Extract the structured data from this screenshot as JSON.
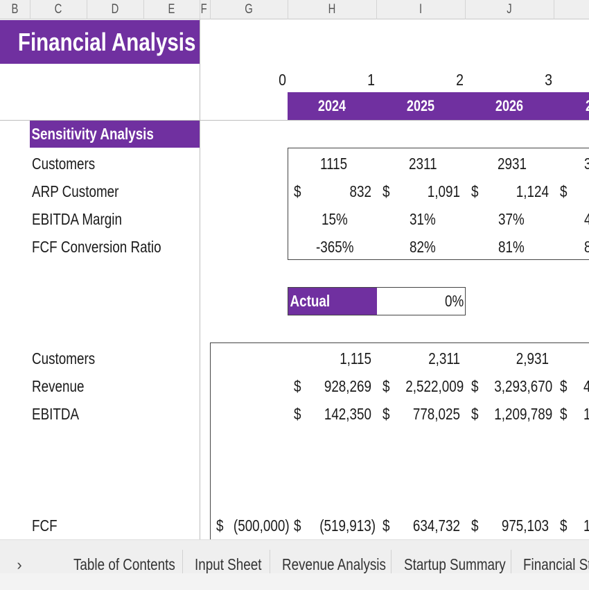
{
  "columns": [
    "B",
    "C",
    "D",
    "E",
    "F",
    "G",
    "H",
    "I",
    "J"
  ],
  "title": "Financial Analysis",
  "period_index": [
    "0",
    "1",
    "2",
    "3"
  ],
  "years": [
    "2024",
    "2025",
    "2026",
    "2"
  ],
  "sensitivity": {
    "header": "Sensitivity Analysis",
    "rows": [
      {
        "label": "Customers",
        "values": [
          "1115",
          "2311",
          "2931",
          "3"
        ]
      },
      {
        "label": "ARP Customer",
        "currency": "$",
        "values": [
          "832",
          "1,091",
          "1,124",
          ""
        ]
      },
      {
        "label": "EBITDA Margin",
        "values": [
          "15%",
          "31%",
          "37%",
          "4"
        ]
      },
      {
        "label": "FCF Conversion Ratio",
        "values": [
          "-365%",
          "82%",
          "81%",
          "8"
        ]
      }
    ]
  },
  "actual": {
    "label": "Actual",
    "value": "0%"
  },
  "summary": {
    "rows": [
      {
        "label": "Customers",
        "values": [
          "1,115",
          "2,311",
          "2,931",
          ""
        ]
      },
      {
        "label": "Revenue",
        "currency": "$",
        "values": [
          "928,269",
          "2,522,009",
          "3,293,670",
          "4"
        ]
      },
      {
        "label": "EBITDA",
        "currency": "$",
        "values": [
          "142,350",
          "778,025",
          "1,209,789",
          "1"
        ]
      }
    ],
    "fcf": {
      "label": "FCF",
      "currency": "$",
      "initial": "(500,000)",
      "values": [
        "(519,913)",
        "634,732",
        "975,103",
        "1"
      ]
    }
  },
  "sheet_tabs": {
    "nav_icon": "chevron-right",
    "nav_glyph": "›",
    "tabs": [
      "Table of Contents",
      "Input Sheet",
      "Revenue Analysis",
      "Startup Summary",
      "Financial Sta"
    ]
  },
  "colors": {
    "accent": "#7030a0"
  }
}
